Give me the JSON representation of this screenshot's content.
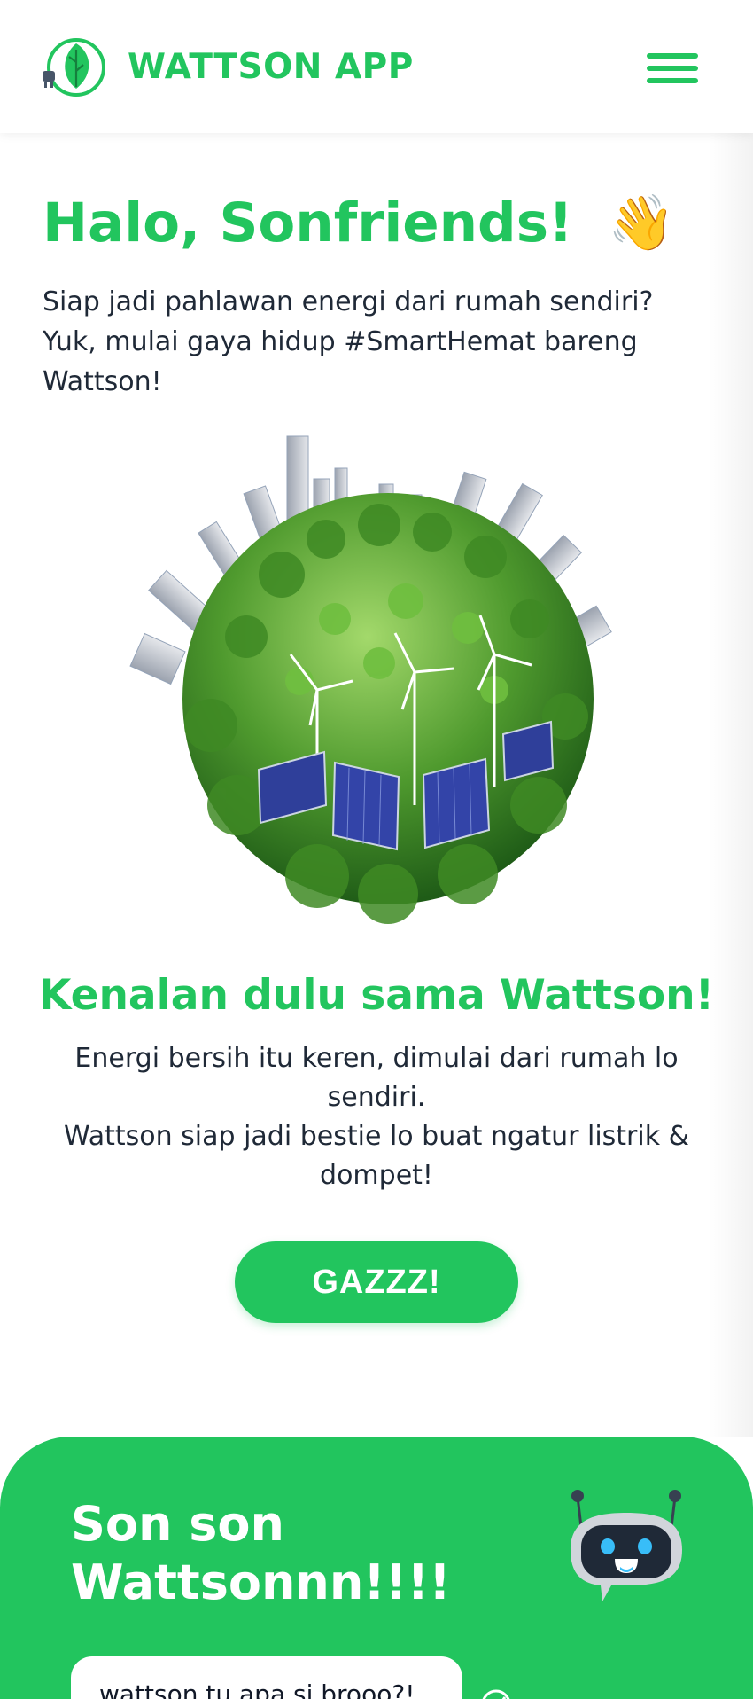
{
  "header": {
    "brand": "WATTSON APP",
    "logo_icon": "plug-leaf-logo-icon",
    "menu_icon": "hamburger-menu-icon"
  },
  "hero": {
    "greeting": "Halo, Sonfriends!",
    "greeting_emoji": "👋",
    "intro": "Siap jadi pahlawan energi dari rumah sendiri? Yuk, mulai gaya hidup #SmartHemat bareng Wattson!",
    "image_icon": "green-city-globe-illustration"
  },
  "about": {
    "title": "Kenalan dulu sama Wattson!",
    "line1": "Energi bersih itu keren, dimulai dari rumah lo sendiri.",
    "line2": "Wattson siap jadi bestie lo buat ngatur listrik & dompet!",
    "cta_label": "GAZZZ!"
  },
  "chat": {
    "title": "Son son Wattsonnn!!!!",
    "bot_icon": "robot-chat-icon",
    "message": "wattson tu apa si brooo?!",
    "send_icon": "send-icon"
  },
  "colors": {
    "accent": "#22c55e",
    "text": "#1f2937",
    "white": "#ffffff"
  }
}
